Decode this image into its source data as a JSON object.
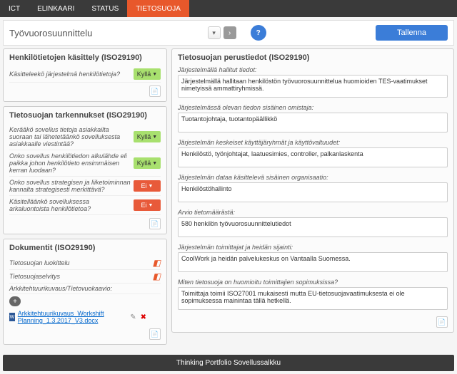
{
  "nav": {
    "items": [
      "ICT",
      "ELINKAARI",
      "STATUS",
      "TIETOSUOJA"
    ],
    "activeIndex": 3
  },
  "header": {
    "title": "Työvuorosuunnittelu",
    "saveLabel": "Tallenna"
  },
  "panel_personal": {
    "title": "Henkilötietojen käsittely (ISO29190)",
    "q1": {
      "label": "Käsitteleekö järjestelmä henkilötietoja?",
      "value": "Kyllä",
      "yes": true
    }
  },
  "panel_refine": {
    "title": "Tietosuojan tarkennukset (ISO29190)",
    "rows": [
      {
        "label": "Kerääkö sovellus tietoja asiakkailta suoraan tai lähetetäänkö sovelluksesta asiakkaalle viestintää?",
        "value": "Kyllä",
        "yes": true
      },
      {
        "label": "Onko sovellus henkilötiedon alkulähde eli paikka johon henkilötieto ensimmäisen kerran luodaan?",
        "value": "Kyllä",
        "yes": true
      },
      {
        "label": "Onko sovellus strategisen ja liiketoiminnan kannalta strategisesti merkittävä?",
        "value": "Ei",
        "yes": false
      },
      {
        "label": "Käsitelläänkö sovelluksessa arkaluontoista henkilötietoa?",
        "value": "Ei",
        "yes": false
      }
    ]
  },
  "panel_docs": {
    "title": "Dokumentit (ISO29190)",
    "links": [
      "Tietosuojan luokittelu",
      "Tietosuojaselvitys",
      "Arkkitehtuurikuvaus/Tietovuokaavio:"
    ],
    "file": "Arkkitehtuurikuvaus_Workshift Planning_1.3.2017_V3.docx"
  },
  "panel_basic": {
    "title": "Tietosuojan perustiedot (ISO29190)",
    "fields": [
      {
        "label": "Järjestelmällä hallitut tiedot:",
        "value": "Järjestelmällä hallitaan henkilöstön työvuorosuunnittelua huomioiden TES-vaatimukset nimetyissä ammattiryhmissä.",
        "tall": true
      },
      {
        "label": "Järjestelmässä olevan tiedon sisäinen omistaja:",
        "value": "Tuotantojohtaja, tuotantopäällikkö"
      },
      {
        "label": "Järjestelmän keskeiset käyttäjäryhmät ja käyttövaltuudet:",
        "value": "Henkilöstö, työnjohtajat, laatuesimies, controller, palkanlaskenta"
      },
      {
        "label": "Järjestelmän dataa käsittelevä sisäinen organisaatio:",
        "value": "Henkilöstöhallinto"
      },
      {
        "label": "Arvio tietomäärästä:",
        "value": "580 henkilön työvuorosuunnittelutiedot"
      },
      {
        "label": "Järjestelmän toimittajat ja heidän sijainti:",
        "value": "CoolWork ja heidän palvelukeskus on Vantaalla Suomessa."
      },
      {
        "label": "Miten tietosuoja on huomioitu toimittajien sopimuksissa?",
        "value": "Toimittaja toimii ISO27001 mukaisesti mutta EU-tietosuojavaatimuksesta ei ole sopimuksessa mainintaa tällä hetkellä.",
        "tall": true
      }
    ]
  },
  "footer": "Thinking Portfolio Sovellussalkku"
}
